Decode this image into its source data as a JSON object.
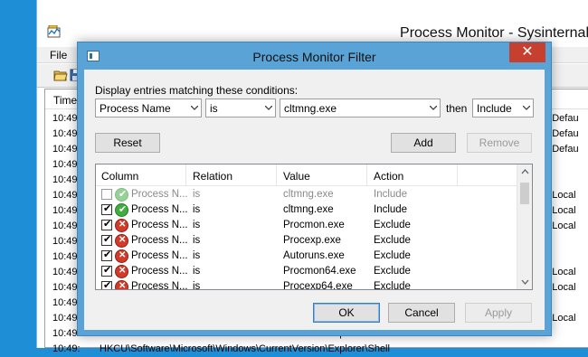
{
  "background_window": {
    "title": "Process Monitor - Sysinternal",
    "menu_file": "File",
    "column_time": "Time",
    "rows": [
      {
        "time": "10:49:",
        "path": "ta\\Defau"
      },
      {
        "time": "10:49:",
        "path": "ta\\Defau"
      },
      {
        "time": "10:49:",
        "path": "ta\\Defau"
      },
      {
        "time": "10:49:",
        "path": "ta"
      },
      {
        "time": "10:49:",
        "path": "ta"
      },
      {
        "time": "10:49:",
        "path": "ta\\Local"
      },
      {
        "time": "10:49:",
        "path": "ta\\Local"
      },
      {
        "time": "10:49:",
        "path": "ta\\Local"
      },
      {
        "time": "10:49:",
        "path": "ta"
      },
      {
        "time": "10:49:",
        "path": "ta"
      },
      {
        "time": "10:49:",
        "path": "ta\\Local"
      },
      {
        "time": "10:49:",
        "path": "ta\\Local"
      },
      {
        "time": "10:49:",
        "path": "ta"
      },
      {
        "time": "10:49:",
        "path": "ta\\Local"
      }
    ],
    "bottom_time_1": "10:49:",
    "bottom_text_1": "HKCU\\Software\\Microsoft\\Windows\\CurrentVersion\\Explorer\\Shell",
    "bottom_time_2": "10:49:",
    "bottom_text_2": "HKCU\\Software\\Microsoft\\Windows\\CurrentVersion\\Explorer\\Shell"
  },
  "dialog": {
    "title": "Process Monitor Filter",
    "close_glyph": "✕",
    "label_display": "Display entries matching these conditions:",
    "column_combo": "Process Name",
    "relation_combo": "is",
    "value_combo": "cltmng.exe",
    "label_then": "then",
    "action_combo": "Include",
    "reset_label": "Reset",
    "add_label": "Add",
    "remove_label": "Remove",
    "ok_label": "OK",
    "cancel_label": "Cancel",
    "apply_label": "Apply",
    "list_headers": {
      "column": "Column",
      "relation": "Relation",
      "value": "Value",
      "action": "Action"
    },
    "filters": [
      {
        "checked": false,
        "status": "include",
        "column": "Process N...",
        "relation": "is",
        "value": "cltmng.exe",
        "action": "Include",
        "dim": true
      },
      {
        "checked": true,
        "status": "include",
        "column": "Process N...",
        "relation": "is",
        "value": "cltmng.exe",
        "action": "Include",
        "dim": false
      },
      {
        "checked": true,
        "status": "exclude",
        "column": "Process N...",
        "relation": "is",
        "value": "Procmon.exe",
        "action": "Exclude",
        "dim": false
      },
      {
        "checked": true,
        "status": "exclude",
        "column": "Process N...",
        "relation": "is",
        "value": "Procexp.exe",
        "action": "Exclude",
        "dim": false
      },
      {
        "checked": true,
        "status": "exclude",
        "column": "Process N...",
        "relation": "is",
        "value": "Autoruns.exe",
        "action": "Exclude",
        "dim": false
      },
      {
        "checked": true,
        "status": "exclude",
        "column": "Process N...",
        "relation": "is",
        "value": "Procmon64.exe",
        "action": "Exclude",
        "dim": false
      },
      {
        "checked": true,
        "status": "exclude",
        "column": "Process N...",
        "relation": "is",
        "value": "Procexp64.exe",
        "action": "Exclude",
        "dim": false
      }
    ]
  },
  "colors": {
    "desktop": "#1e8fd6",
    "dialog_frame": "#5aa3d6",
    "close_button": "#c7402f",
    "include_icon": "#3fae3f",
    "exclude_icon": "#d23a2a"
  }
}
